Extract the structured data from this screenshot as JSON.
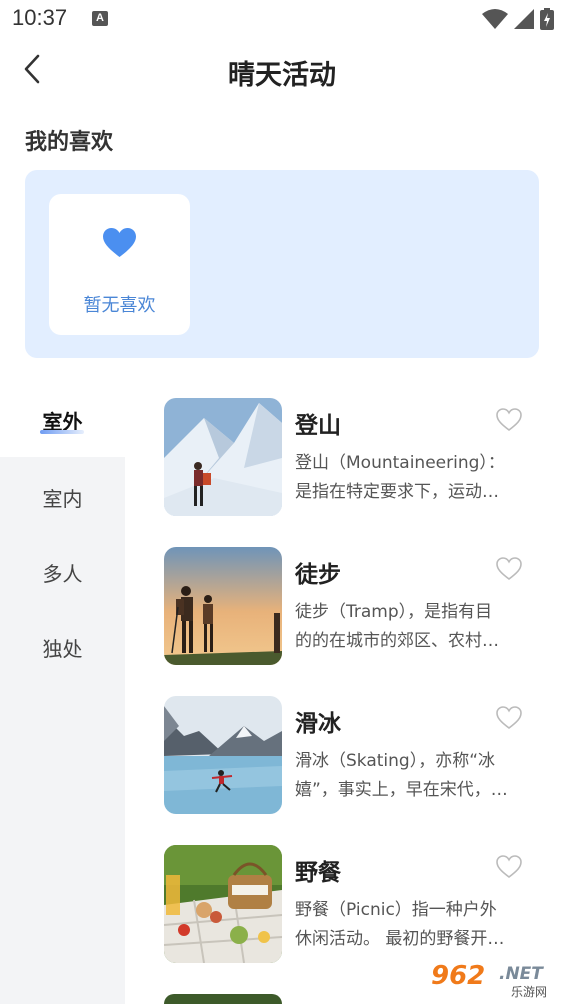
{
  "status_bar": {
    "time": "10:37",
    "notif_letter": "A"
  },
  "header": {
    "title": "晴天活动"
  },
  "favorites": {
    "section_title": "我的喜欢",
    "empty_text": "暂无喜欢"
  },
  "categories": [
    {
      "label": "室外",
      "active": true
    },
    {
      "label": "室内",
      "active": false
    },
    {
      "label": "多人",
      "active": false
    },
    {
      "label": "独处",
      "active": false
    }
  ],
  "activities": [
    {
      "title": "登山",
      "desc_line1": "登山（Mountaineering）：",
      "desc_line2": "是指在特定要求下，运动…",
      "thumb": "snowy mountain climber"
    },
    {
      "title": "徒步",
      "desc_line1": "徒步（Tramp），是指有目",
      "desc_line2": "的的在城市的郊区、农村…",
      "thumb": "hikers at sunset"
    },
    {
      "title": "滑冰",
      "desc_line1": "滑冰（Skating），亦称“冰",
      "desc_line2": "嬉”，事实上，早在宋代，…",
      "thumb": "skater on frozen lake"
    },
    {
      "title": "野餐",
      "desc_line1": "野餐（Picnic）指一种户外",
      "desc_line2": "休闲活动。 最初的野餐开…",
      "thumb": "picnic basket on grass"
    }
  ],
  "watermark": {
    "number": "962",
    "suffix": ".NET",
    "caption": "乐游网"
  },
  "colors": {
    "accent": "#4a86d6",
    "heart_fill": "#4b8ff0",
    "panel_bg": "#e2eeff",
    "sidebar_bg": "#f3f4f6"
  }
}
